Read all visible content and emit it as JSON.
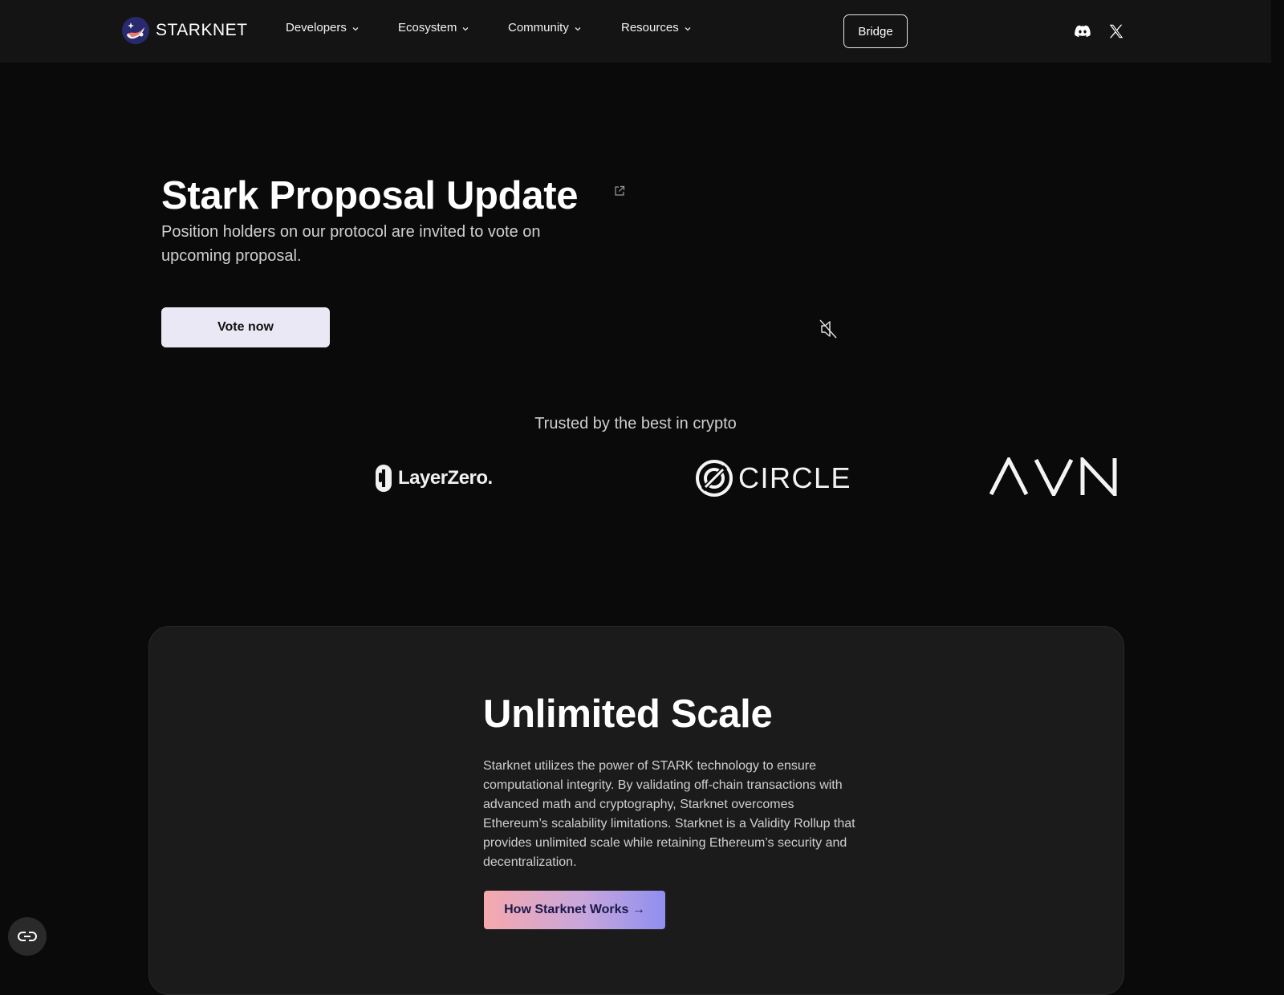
{
  "nav": {
    "brand": "STARKNET",
    "menu": [
      {
        "label": "Developers"
      },
      {
        "label": "Ecosystem"
      },
      {
        "label": "Community"
      },
      {
        "label": "Resources"
      }
    ],
    "bridge_label": "Bridge",
    "social_icons": [
      "discord-icon",
      "x-icon"
    ]
  },
  "hero": {
    "title": "Stark Proposal Update",
    "subtitle": "Position holders on our protocol are invited to vote on upcoming proposal.",
    "vote_label": "Vote now"
  },
  "trusted": {
    "heading": "Trusted by the best in crypto",
    "logos": [
      {
        "name": "LayerZero",
        "text": "LayerZero."
      },
      {
        "name": "Circle",
        "text": "CIRCLE"
      },
      {
        "name": "AVN",
        "text": "AVN"
      }
    ]
  },
  "scale": {
    "title": "Unlimited Scale",
    "body": "Starknet utilizes the power of STARK technology to ensure computational integrity. By validating off-chain transactions with advanced math and cryptography, Starknet overcomes Ethereum’s scalability limitations. Starknet is a Validity Rollup that provides unlimited scale while retaining Ethereum’s security and decentralization.",
    "button_label": "How Starknet Works →"
  },
  "colors": {
    "background": "#0a0a0a",
    "nav_bg": "#141414",
    "card_bg": "#1b1b1b",
    "vote_button_bg": "#ebe8f6",
    "gradient_start": "#f6a9ad",
    "gradient_end": "#8f8ff0"
  },
  "icons": {
    "external_link": "external-link-icon",
    "mute": "speaker-muted-icon",
    "floating": "link-icon"
  }
}
